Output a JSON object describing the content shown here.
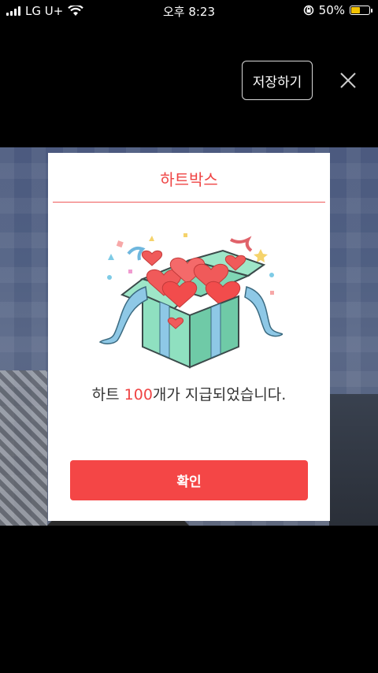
{
  "status_bar": {
    "carrier": "LG U+",
    "time": "오후 8:23",
    "battery": "50%"
  },
  "header": {
    "save_label": "저장하기"
  },
  "dialog": {
    "title": "하트박스",
    "message_prefix": "하트 ",
    "message_count": "100",
    "message_suffix": "개가 지급되었습니다.",
    "confirm_label": "확인"
  },
  "colors": {
    "accent": "#f44646",
    "battery": "#f2c200"
  },
  "icons": [
    "signal-icon",
    "wifi-icon",
    "rotation-lock-icon",
    "battery-icon",
    "close-icon",
    "gift-box-illustration"
  ]
}
